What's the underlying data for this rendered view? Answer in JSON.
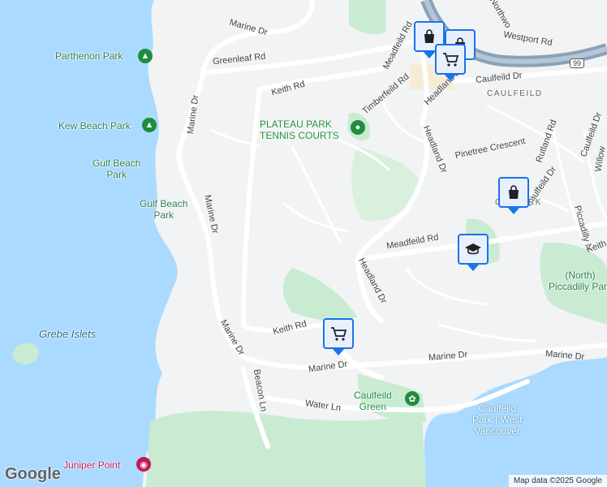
{
  "colors": {
    "water": "#aadaff",
    "land": "#f1f3f4",
    "park": "#c8ebd1",
    "road": "#ffffff",
    "highway": "#8ba2b8",
    "pin_border": "#1a73e8"
  },
  "roads": {
    "marine_dr_1": "Marine Dr",
    "marine_dr_2": "Marine Dr",
    "marine_dr_3": "Marine Dr",
    "marine_dr_4": "Marine Dr",
    "marine_dr_5": "Marine Dr",
    "marine_dr_6": "Marine Dr",
    "greenleaf_rd": "Greenleaf Rd",
    "keith_rd_1": "Keith Rd",
    "keith_rd_2": "Keith Rd",
    "keith_rd_3": "Keith Rd",
    "meadfeild_rd_1": "Meadfeild Rd",
    "meadfeild_rd_2": "Meadfeild Rd",
    "timberfeild_rd": "Timberfeild Rd",
    "headland_dr_1": "Headland Dr",
    "headland_dr_2": "Headland Dr",
    "headland_dr_3": "Headland Dr",
    "headland_dr_4": "Headland Dr",
    "westport_rd": "Westport Rd",
    "caulfeild_dr_1": "Caulfeild Dr",
    "caulfeild_dr_2": "Caulfeild Dr",
    "caulfeild_dr_3": "Caulfeild Dr",
    "pinetree_cres": "Pinetree Crescent",
    "rutland_rd": "Rutland Rd",
    "piccadilly_n": "Piccadilly N",
    "beacon_ln": "Beacon Ln",
    "water_ln": "Water Ln",
    "northwood": "Northwo",
    "willow": "Willow",
    "highway_99": "99"
  },
  "places": {
    "parthenon_park": "Parthenon Park",
    "kew_beach_park": "Kew Beach Park",
    "gulf_beach_park_1": "Gulf Beach\nPark",
    "gulf_beach_park_2": "Gulf Beach\nPark",
    "grebe_islets": "Grebe Islets",
    "plateau_park": "PLATEAU PARK\nTENNIS COURTS",
    "caulfeild_area": "CAULFEILD",
    "cypress_park": "C    S PARK",
    "north_piccadilly_park": "(North)\nPiccadilly Park",
    "caulfeild_green": "Caulfeild\nGreen",
    "caulfeild_park": "Caulfeild\nPark | West\nVancouver",
    "juniper_point": "Juniper Point"
  },
  "pins": [
    {
      "icon": "shopping-bag-icon"
    },
    {
      "icon": "shopping-cart-icon"
    },
    {
      "icon": "shopping-bag-icon"
    },
    {
      "icon": "school-icon"
    },
    {
      "icon": "shopping-cart-icon"
    }
  ],
  "branding": {
    "logo": "Google",
    "attribution": "Map data ©2025 Google"
  }
}
